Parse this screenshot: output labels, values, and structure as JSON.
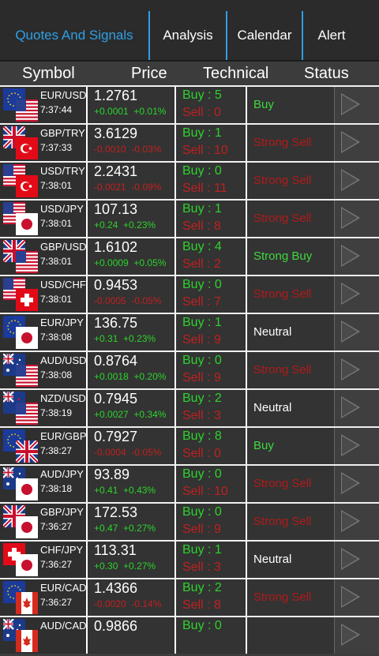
{
  "tabs": [
    {
      "label": "Quotes And Signals",
      "active": true
    },
    {
      "label": "Analysis",
      "active": false
    },
    {
      "label": "Calendar",
      "active": false
    },
    {
      "label": "Alert",
      "active": false
    }
  ],
  "columns": {
    "symbol": "Symbol",
    "price": "Price",
    "technical": "Technical",
    "status": "Status"
  },
  "rows": [
    {
      "pair": "EUR/USD",
      "time": "7:37:44",
      "price": "1.2761",
      "change": "+0.0001",
      "pct": "+0.01%",
      "dir": "up",
      "buy": "Buy : 5",
      "sell": "Sell : 0",
      "status": "Buy",
      "stype": "buyc",
      "flags": [
        "eu",
        "us"
      ]
    },
    {
      "pair": "GBP/TRY",
      "time": "7:37:33",
      "price": "3.6129",
      "change": "-0.0010",
      "pct": "-0.03%",
      "dir": "down",
      "buy": "Buy : 1",
      "sell": "Sell : 10",
      "status": "Strong Sell",
      "stype": "sellc",
      "flags": [
        "gb",
        "tr"
      ]
    },
    {
      "pair": "USD/TRY",
      "time": "7:38:01",
      "price": "2.2431",
      "change": "-0.0021",
      "pct": "-0.09%",
      "dir": "down",
      "buy": "Buy : 0",
      "sell": "Sell : 11",
      "status": "Strong Sell",
      "stype": "sellc",
      "flags": [
        "us",
        "tr"
      ]
    },
    {
      "pair": "USD/JPY",
      "time": "7:38:01",
      "price": "107.13",
      "change": "+0.24",
      "pct": "+0.23%",
      "dir": "up",
      "buy": "Buy : 1",
      "sell": "Sell : 8",
      "status": "Strong Sell",
      "stype": "sellc",
      "flags": [
        "us",
        "jp"
      ]
    },
    {
      "pair": "GBP/USD",
      "time": "7:38:01",
      "price": "1.6102",
      "change": "+0.0009",
      "pct": "+0.05%",
      "dir": "up",
      "buy": "Buy : 4",
      "sell": "Sell : 2",
      "status": "Strong Buy",
      "stype": "buyc",
      "flags": [
        "gb",
        "us"
      ]
    },
    {
      "pair": "USD/CHF",
      "time": "7:38:01",
      "price": "0.9453",
      "change": "-0.0005",
      "pct": "-0.05%",
      "dir": "down",
      "buy": "Buy : 0",
      "sell": "Sell : 7",
      "status": "Strong Sell",
      "stype": "sellc",
      "flags": [
        "us",
        "ch"
      ]
    },
    {
      "pair": "EUR/JPY",
      "time": "7:38:08",
      "price": "136.75",
      "change": "+0.31",
      "pct": "+0.23%",
      "dir": "up",
      "buy": "Buy : 1",
      "sell": "Sell : 9",
      "status": "Neutral",
      "stype": "neutral",
      "flags": [
        "eu",
        "jp"
      ]
    },
    {
      "pair": "AUD/USD",
      "time": "7:38:08",
      "price": "0.8764",
      "change": "+0.0018",
      "pct": "+0.20%",
      "dir": "up",
      "buy": "Buy : 0",
      "sell": "Sell : 9",
      "status": "Strong Sell",
      "stype": "sellc",
      "flags": [
        "au",
        "us"
      ]
    },
    {
      "pair": "NZD/USD",
      "time": "7:38:19",
      "price": "0.7945",
      "change": "+0.0027",
      "pct": "+0.34%",
      "dir": "up",
      "buy": "Buy : 2",
      "sell": "Sell : 3",
      "status": "Neutral",
      "stype": "neutral",
      "flags": [
        "nz",
        "us"
      ]
    },
    {
      "pair": "EUR/GBP",
      "time": "7:38:27",
      "price": "0.7927",
      "change": "-0.0004",
      "pct": "-0.05%",
      "dir": "down",
      "buy": "Buy : 8",
      "sell": "Sell : 0",
      "status": "Buy",
      "stype": "buyc",
      "flags": [
        "eu",
        "gb"
      ]
    },
    {
      "pair": "AUD/JPY",
      "time": "7:38:18",
      "price": "93.89",
      "change": "+0.41",
      "pct": "+0.43%",
      "dir": "up",
      "buy": "Buy : 0",
      "sell": "Sell : 10",
      "status": "Strong Sell",
      "stype": "sellc",
      "flags": [
        "au",
        "jp"
      ]
    },
    {
      "pair": "GBP/JPY",
      "time": "7:36:27",
      "price": "172.53",
      "change": "+0.47",
      "pct": "+0.27%",
      "dir": "up",
      "buy": "Buy : 0",
      "sell": "Sell : 9",
      "status": "Strong Sell",
      "stype": "sellc",
      "flags": [
        "gb",
        "jp"
      ]
    },
    {
      "pair": "CHF/JPY",
      "time": "7:36:27",
      "price": "113.31",
      "change": "+0.30",
      "pct": "+0.27%",
      "dir": "up",
      "buy": "Buy : 1",
      "sell": "Sell : 3",
      "status": "Neutral",
      "stype": "neutral",
      "flags": [
        "ch",
        "jp"
      ]
    },
    {
      "pair": "EUR/CAD",
      "time": "7:36:27",
      "price": "1.4366",
      "change": "-0.0020",
      "pct": "-0.14%",
      "dir": "down",
      "buy": "Buy : 2",
      "sell": "Sell : 8",
      "status": "Strong Sell",
      "stype": "sellc",
      "flags": [
        "eu",
        "ca"
      ]
    },
    {
      "pair": "AUD/CAD",
      "time": "",
      "price": "0.9866",
      "change": "",
      "pct": "",
      "dir": "up",
      "buy": "Buy : 0",
      "sell": "",
      "status": "",
      "stype": "sellc",
      "flags": [
        "au",
        "ca"
      ]
    }
  ],
  "colors": {
    "accent": "#2f9fe6",
    "buy": "#2cd32c",
    "sell": "#c02020",
    "background": "#3c3c3c"
  }
}
